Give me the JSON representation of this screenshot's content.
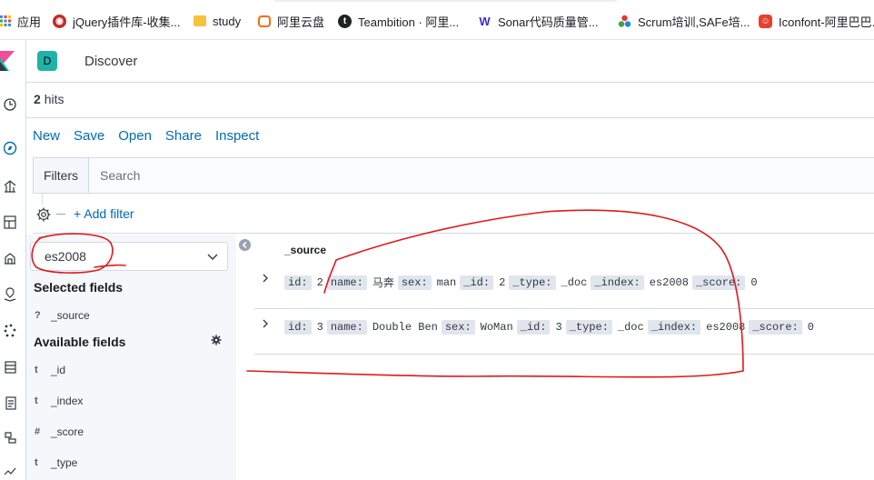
{
  "bookmarks": [
    {
      "label": "应用",
      "icon": "apps-grid-icon",
      "color": "#4285f4"
    },
    {
      "label": "jQuery插件库-收集...",
      "icon": "jquery-favicon",
      "color": "#c62828"
    },
    {
      "label": "study",
      "icon": "folder-icon",
      "color": "#f9c23c"
    },
    {
      "label": "阿里云盘",
      "icon": "aliyun-drive-favicon",
      "color": "#ff6a00"
    },
    {
      "label": "Teambition · 阿里...",
      "icon": "teambition-favicon",
      "color": "#202124"
    },
    {
      "label": "Sonar代码质量管...",
      "icon": "sonar-favicon",
      "color": "#3b2ecc"
    },
    {
      "label": "Scrum培训,SAFe培...",
      "icon": "scrum-favicon",
      "color": "#4caf50"
    },
    {
      "label": "Iconfont-阿里巴巴...",
      "icon": "iconfont-favicon",
      "color": "#e8402d"
    }
  ],
  "app": {
    "space_initial": "D",
    "space_color": "#20b2aa",
    "breadcrumb": "Discover"
  },
  "hits": {
    "count": "2",
    "label": "hits"
  },
  "top_nav": [
    {
      "label": "New"
    },
    {
      "label": "Save"
    },
    {
      "label": "Open"
    },
    {
      "label": "Share"
    },
    {
      "label": "Inspect"
    }
  ],
  "query": {
    "filters_label": "Filters",
    "search_placeholder": "Search",
    "add_filter_label": "+ Add filter"
  },
  "sidebar": {
    "index_pattern": "es2008",
    "selected_title": "Selected fields",
    "selected_fields": [
      {
        "type": "?",
        "name": "_source"
      }
    ],
    "available_title": "Available fields",
    "available_fields": [
      {
        "type": "t",
        "name": "_id"
      },
      {
        "type": "t",
        "name": "_index"
      },
      {
        "type": "#",
        "name": "_score"
      },
      {
        "type": "t",
        "name": "_type"
      }
    ]
  },
  "table": {
    "column": "_source",
    "rows": [
      {
        "pairs": [
          {
            "key": "id:",
            "value": "2"
          },
          {
            "key": "name:",
            "value": "马奔"
          },
          {
            "key": "sex:",
            "value": "man"
          },
          {
            "key": "_id:",
            "value": "2"
          },
          {
            "key": "_type:",
            "value": "_doc"
          },
          {
            "key": "_index:",
            "value": "es2008"
          },
          {
            "key": "_score:",
            "value": "0"
          }
        ]
      },
      {
        "pairs": [
          {
            "key": "id:",
            "value": "3"
          },
          {
            "key": "name:",
            "value": "Double Ben"
          },
          {
            "key": "sex:",
            "value": "WoMan"
          },
          {
            "key": "_id:",
            "value": "3"
          },
          {
            "key": "_type:",
            "value": "_doc"
          },
          {
            "key": "_index:",
            "value": "es2008"
          },
          {
            "key": "_score:",
            "value": "0"
          }
        ]
      }
    ]
  },
  "colors": {
    "link": "#006bb4",
    "annotation": "#e0191b",
    "border": "#d3dae6",
    "sidebar_bg": "#f5f7fa"
  }
}
